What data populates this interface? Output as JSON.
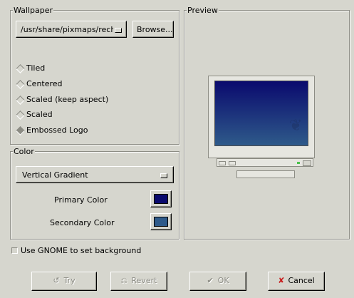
{
  "wallpaper": {
    "title": "Wallpaper",
    "file_path": "/usr/share/pixmaps/recha",
    "browse_label": "Browse...",
    "options": [
      {
        "label": "Tiled",
        "checked": false
      },
      {
        "label": "Centered",
        "checked": false
      },
      {
        "label": "Scaled (keep aspect)",
        "checked": false
      },
      {
        "label": "Scaled",
        "checked": false
      },
      {
        "label": "Embossed Logo",
        "checked": true
      }
    ]
  },
  "preview": {
    "title": "Preview",
    "gradient_top": "#0a0a6e",
    "gradient_bottom": "#2e5a8a"
  },
  "color": {
    "title": "Color",
    "gradient_type": "Vertical Gradient",
    "primary_label": "Primary Color",
    "primary_value": "#0a0a6e",
    "secondary_label": "Secondary Color",
    "secondary_value": "#2e5a8a"
  },
  "use_gnome": {
    "label": "Use GNOME to set background",
    "checked": false
  },
  "buttons": {
    "try": "Try",
    "revert": "Revert",
    "ok": "OK",
    "cancel": "Cancel"
  }
}
